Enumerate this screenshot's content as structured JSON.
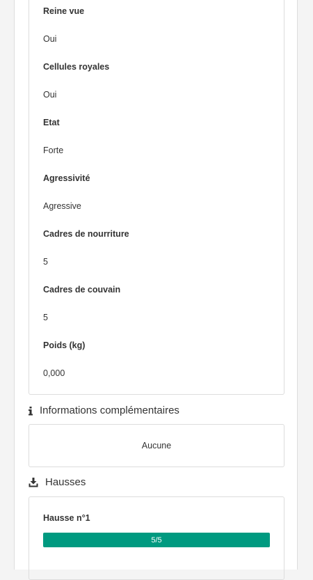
{
  "details": {
    "fields": [
      {
        "label": "Reine vue",
        "value": "Oui"
      },
      {
        "label": "Cellules royales",
        "value": "Oui"
      },
      {
        "label": "Etat",
        "value": "Forte"
      },
      {
        "label": "Agressivité",
        "value": "Agressive"
      },
      {
        "label": "Cadres de nourriture",
        "value": "5"
      },
      {
        "label": "Cadres de couvain",
        "value": "5"
      },
      {
        "label": "Poids (kg)",
        "value": "0,000"
      }
    ]
  },
  "info_section": {
    "icon": "info-icon",
    "title": "Informations complémentaires",
    "content": "Aucune"
  },
  "hausses_section": {
    "icon": "download-icon",
    "title": "Hausses",
    "items": [
      {
        "title": "Hausse n°1",
        "progress_text": "5/5",
        "progress_fraction": 1.0
      }
    ]
  },
  "colors": {
    "accent": "#009a80",
    "border": "#dddddd",
    "text": "#333333"
  }
}
